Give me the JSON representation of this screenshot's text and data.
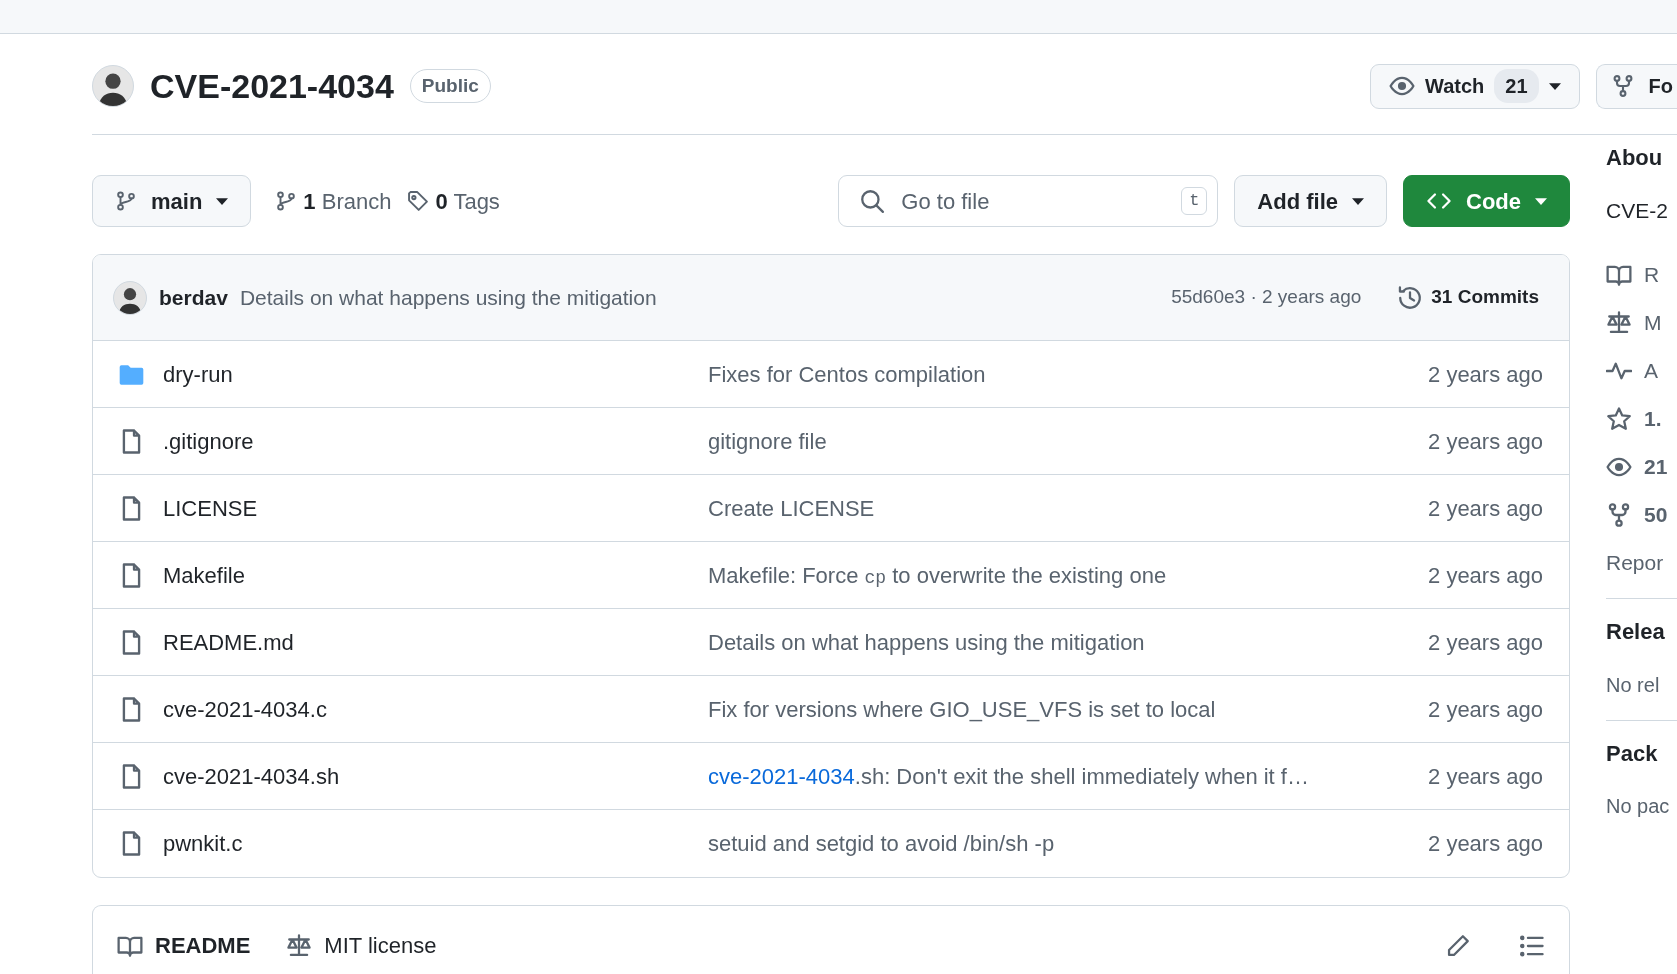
{
  "repo": {
    "name": "CVE-2021-4034",
    "visibility": "Public"
  },
  "actions": {
    "watch": {
      "label": "Watch",
      "count": "21"
    },
    "fork": {
      "label": "Fo"
    }
  },
  "toolbar": {
    "branch": "main",
    "branches": "1 Branch",
    "tags": "0 Tags",
    "search": {
      "placeholder": "Go to file",
      "shortcut": "t"
    },
    "add_file": "Add file",
    "code": "Code"
  },
  "latest_commit": {
    "author": "berdav",
    "message": "Details on what happens using the mitigation",
    "hash": "55d60e3 · 2 years ago",
    "commits": "31 Commits"
  },
  "files": [
    {
      "kind": "folder",
      "name": "dry-run",
      "message": [
        {
          "kind": "text",
          "text": "Fixes for Centos compilation"
        }
      ],
      "time": "2 years ago"
    },
    {
      "kind": "file",
      "name": ".gitignore",
      "message": [
        {
          "kind": "text",
          "text": "gitignore file"
        }
      ],
      "time": "2 years ago"
    },
    {
      "kind": "file",
      "name": "LICENSE",
      "message": [
        {
          "kind": "text",
          "text": "Create LICENSE"
        }
      ],
      "time": "2 years ago"
    },
    {
      "kind": "file",
      "name": "Makefile",
      "message": [
        {
          "kind": "text",
          "text": "Makefile: Force "
        },
        {
          "kind": "code",
          "text": "cp"
        },
        {
          "kind": "text",
          "text": " to overwrite the existing one"
        }
      ],
      "time": "2 years ago"
    },
    {
      "kind": "file",
      "name": "README.md",
      "message": [
        {
          "kind": "text",
          "text": "Details on what happens using the mitigation"
        }
      ],
      "time": "2 years ago"
    },
    {
      "kind": "file",
      "name": "cve-2021-4034.c",
      "message": [
        {
          "kind": "text",
          "text": "Fix for versions where GIO_USE_VFS is set to local"
        }
      ],
      "time": "2 years ago"
    },
    {
      "kind": "file",
      "name": "cve-2021-4034.sh",
      "message": [
        {
          "kind": "link",
          "text": "cve-2021-4034"
        },
        {
          "kind": "text",
          "text": ".sh: Don't exit the shell immediately when it f…"
        }
      ],
      "time": "2 years ago"
    },
    {
      "kind": "file",
      "name": "pwnkit.c",
      "message": [
        {
          "kind": "text",
          "text": "setuid and setgid to avoid /bin/sh -p"
        }
      ],
      "time": "2 years ago"
    }
  ],
  "readme_bar": {
    "tabs": [
      {
        "kind": "book",
        "label": "README",
        "selected": true
      },
      {
        "kind": "scale",
        "label": "MIT license",
        "selected": false
      }
    ]
  },
  "sidebar": {
    "title": "Abou",
    "description": "CVE-2",
    "items": [
      {
        "kind": "book",
        "text": "R"
      },
      {
        "kind": "scale",
        "text": "M"
      },
      {
        "kind": "pulse",
        "text": "A"
      },
      {
        "kind": "star",
        "text": "1."
      },
      {
        "kind": "eye",
        "text": "21"
      },
      {
        "kind": "fork",
        "text": "50"
      }
    ],
    "report": "Repor",
    "releases": {
      "title": "Relea",
      "note": "No rel"
    },
    "packages": {
      "title": "Pack",
      "note": "No pac"
    }
  }
}
